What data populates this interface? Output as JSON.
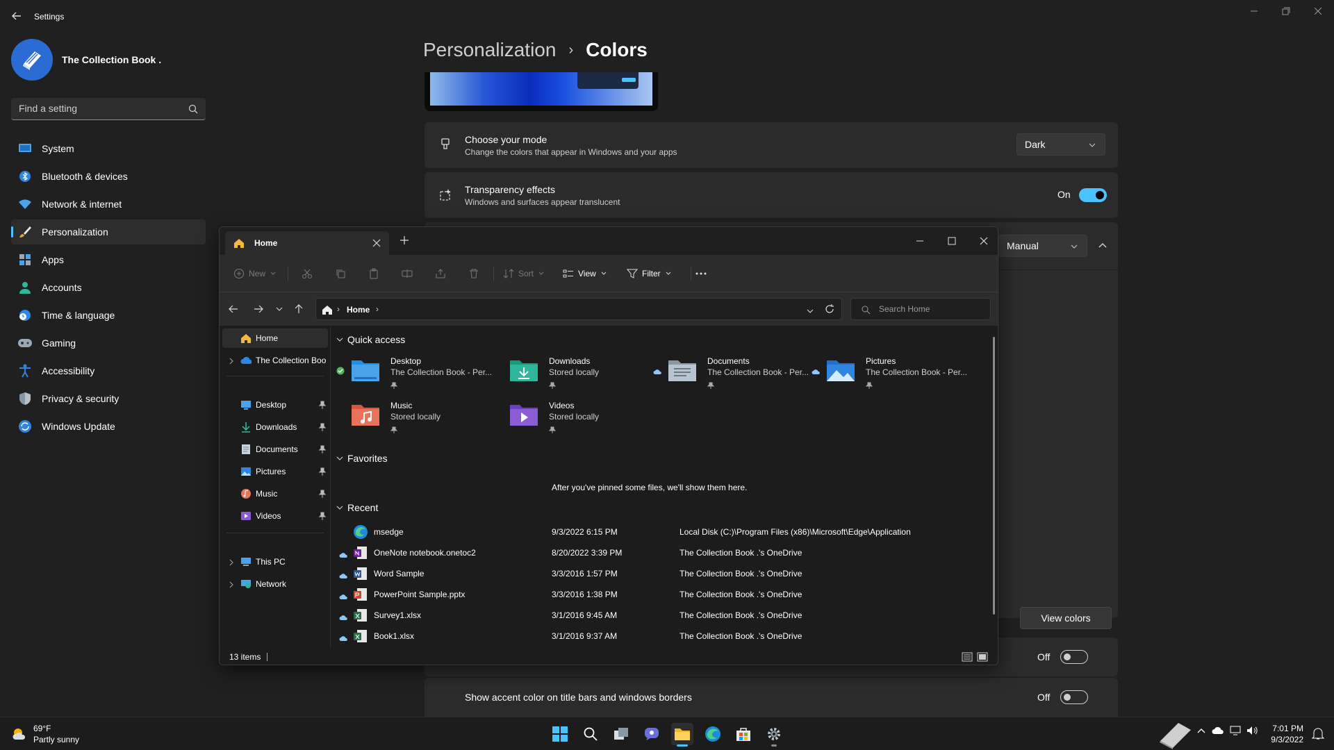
{
  "settings": {
    "title": "Settings",
    "profile": {
      "name": "The Collection Book ."
    },
    "search": {
      "placeholder": "Find a setting"
    },
    "nav": [
      {
        "label": "System",
        "icon": "monitor-icon"
      },
      {
        "label": "Bluetooth & devices",
        "icon": "bluetooth-icon"
      },
      {
        "label": "Network & internet",
        "icon": "wifi-icon"
      },
      {
        "label": "Personalization",
        "icon": "brush-icon",
        "active": true
      },
      {
        "label": "Apps",
        "icon": "apps-icon"
      },
      {
        "label": "Accounts",
        "icon": "person-icon"
      },
      {
        "label": "Time & language",
        "icon": "globe-clock-icon"
      },
      {
        "label": "Gaming",
        "icon": "gamepad-icon"
      },
      {
        "label": "Accessibility",
        "icon": "accessibility-icon"
      },
      {
        "label": "Privacy & security",
        "icon": "shield-icon"
      },
      {
        "label": "Windows Update",
        "icon": "update-icon"
      }
    ],
    "breadcrumb": {
      "parent": "Personalization",
      "separator": "›",
      "current": "Colors"
    },
    "mode": {
      "title": "Choose your mode",
      "subtitle": "Change the colors that appear in Windows and your apps",
      "value": "Dark"
    },
    "transparency": {
      "title": "Transparency effects",
      "subtitle": "Windows and surfaces appear translucent",
      "state": "On"
    },
    "accent": {
      "value": "Manual"
    },
    "view_colors_label": "View colors",
    "start_taskbar_toggle": {
      "state": "Off"
    },
    "title_bars": {
      "title": "Show accent color on title bars and windows borders",
      "state": "Off"
    },
    "accent_color": "#4cc2ff"
  },
  "explorer": {
    "tab_label": "Home",
    "toolbar": {
      "new": "New",
      "sort": "Sort",
      "view": "View",
      "filter": "Filter"
    },
    "address": {
      "location": "Home",
      "separator": "›"
    },
    "search_placeholder": "Search Home",
    "sidebar": {
      "home": "Home",
      "onedrive": "The Collection Boo",
      "pinned": [
        "Desktop",
        "Downloads",
        "Documents",
        "Pictures",
        "Music",
        "Videos"
      ],
      "this_pc": "This PC",
      "network": "Network"
    },
    "sections": {
      "quick_access": "Quick access",
      "favorites": "Favorites",
      "recent": "Recent"
    },
    "quick_access": [
      {
        "name": "Desktop",
        "sub": "The Collection Book - Per...",
        "icon": "desktop-folder-icon"
      },
      {
        "name": "Downloads",
        "sub": "Stored locally",
        "icon": "downloads-folder-icon"
      },
      {
        "name": "Documents",
        "sub": "The Collection Book - Per...",
        "icon": "documents-folder-icon"
      },
      {
        "name": "Pictures",
        "sub": "The Collection Book - Per...",
        "icon": "pictures-folder-icon"
      },
      {
        "name": "Music",
        "sub": "Stored locally",
        "icon": "music-folder-icon"
      },
      {
        "name": "Videos",
        "sub": "Stored locally",
        "icon": "videos-folder-icon"
      }
    ],
    "favorites_message": "After you've pinned some files, we'll show them here.",
    "recent": [
      {
        "name": "msedge",
        "date": "9/3/2022 6:15 PM",
        "location": "Local Disk (C:)\\Program Files (x86)\\Microsoft\\Edge\\Application",
        "icon": "edge-icon"
      },
      {
        "name": "OneNote notebook.onetoc2",
        "date": "8/20/2022 3:39 PM",
        "location": "The Collection Book .'s OneDrive",
        "icon": "onenote-icon"
      },
      {
        "name": "Word Sample",
        "date": "3/3/2016 1:57 PM",
        "location": "The Collection Book .'s OneDrive",
        "icon": "word-icon"
      },
      {
        "name": "PowerPoint Sample.pptx",
        "date": "3/3/2016 1:38 PM",
        "location": "The Collection Book .'s OneDrive",
        "icon": "powerpoint-icon"
      },
      {
        "name": "Survey1.xlsx",
        "date": "3/1/2016 9:45 AM",
        "location": "The Collection Book .'s OneDrive",
        "icon": "excel-icon"
      },
      {
        "name": "Book1.xlsx",
        "date": "3/1/2016 9:37 AM",
        "location": "The Collection Book .'s OneDrive",
        "icon": "excel-icon"
      }
    ],
    "status": {
      "count": "13 items"
    }
  },
  "taskbar": {
    "weather": {
      "temp": "69°F",
      "condition": "Partly sunny"
    },
    "clock": {
      "time": "7:01 PM",
      "date": "9/3/2022"
    }
  }
}
